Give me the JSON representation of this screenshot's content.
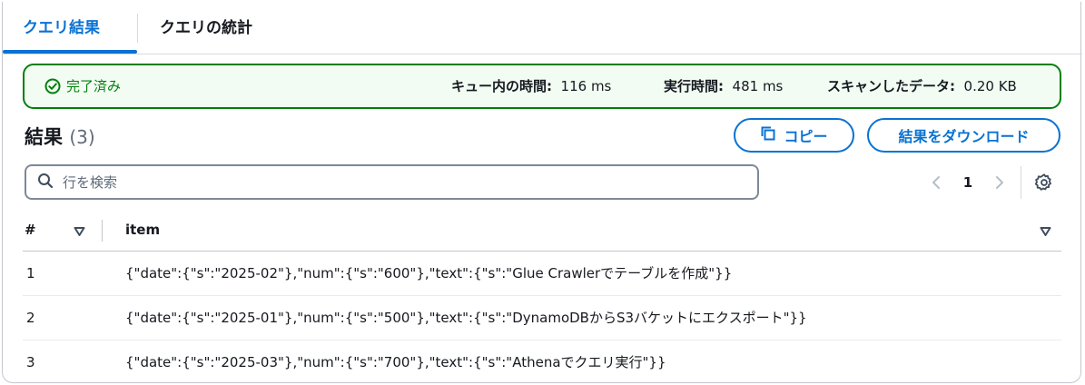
{
  "tabs": [
    {
      "label": "クエリ結果",
      "active": true
    },
    {
      "label": "クエリの統計",
      "active": false
    }
  ],
  "status": {
    "state": "完了済み",
    "queue_label": "キュー内の時間:",
    "queue_value": "116 ms",
    "run_label": "実行時間:",
    "run_value": "481 ms",
    "scan_label": "スキャンしたデータ:",
    "scan_value": "0.20 KB"
  },
  "results": {
    "title": "結果",
    "count": "(3)",
    "copy_label": "コピー",
    "download_label": "結果をダウンロード"
  },
  "search": {
    "placeholder": "行を検索"
  },
  "pagination": {
    "current_page": "1"
  },
  "table": {
    "columns": [
      "#",
      "item"
    ],
    "rows": [
      {
        "num": "1",
        "item": "{\"date\":{\"s\":\"2025-02\"},\"num\":{\"s\":\"600\"},\"text\":{\"s\":\"Glue Crawlerでテーブルを作成\"}}"
      },
      {
        "num": "2",
        "item": "{\"date\":{\"s\":\"2025-01\"},\"num\":{\"s\":\"500\"},\"text\":{\"s\":\"DynamoDBからS3バケットにエクスポート\"}}"
      },
      {
        "num": "3",
        "item": "{\"date\":{\"s\":\"2025-03\"},\"num\":{\"s\":\"700\"},\"text\":{\"s\":\"Athenaでクエリ実行\"}}"
      }
    ]
  },
  "colors": {
    "accent": "#0972d3",
    "success": "#037f0c",
    "success_bg": "#f2fcf3"
  },
  "icons": [
    "check-circle-icon",
    "copy-icon",
    "search-icon",
    "chevron-left-icon",
    "chevron-right-icon",
    "gear-icon",
    "sort-down-icon"
  ]
}
